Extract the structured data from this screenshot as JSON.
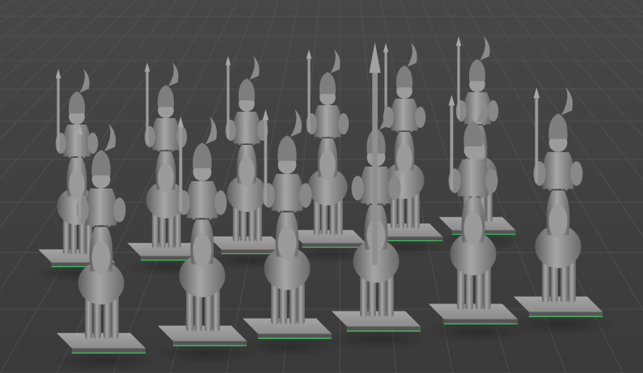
{
  "scene": {
    "background": "#3f3f3f",
    "grid_color": "#5a5a5a",
    "model_color": "#8e8e8e",
    "model_highlight": "#b9b9b9",
    "model_shadow": "#5c5c5c",
    "base_color": "#9a9a9a",
    "base_edge_color": "#3fbf5f",
    "back_row_count": 6,
    "front_row_count": 6
  }
}
